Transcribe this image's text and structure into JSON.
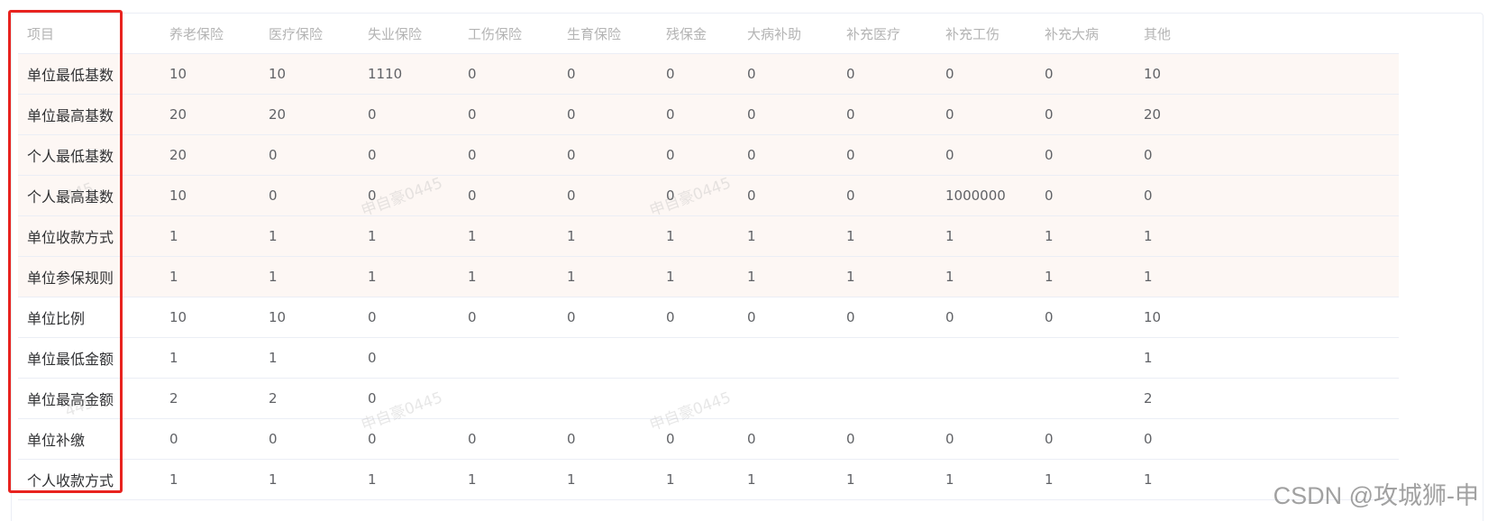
{
  "table": {
    "headers": [
      "项目",
      "养老保险",
      "医疗保险",
      "失业保险",
      "工伤保险",
      "生育保险",
      "残保金",
      "大病补助",
      "补充医疗",
      "补充工伤",
      "补充大病",
      "其他"
    ],
    "rows": [
      [
        "单位最低基数",
        "10",
        "10",
        "1110",
        "0",
        "0",
        "0",
        "0",
        "0",
        "0",
        "0",
        "10"
      ],
      [
        "单位最高基数",
        "20",
        "20",
        "0",
        "0",
        "0",
        "0",
        "0",
        "0",
        "0",
        "0",
        "20"
      ],
      [
        "个人最低基数",
        "20",
        "0",
        "0",
        "0",
        "0",
        "0",
        "0",
        "0",
        "0",
        "0",
        "0"
      ],
      [
        "个人最高基数",
        "10",
        "0",
        "0",
        "0",
        "0",
        "0",
        "0",
        "0",
        "1000000",
        "0",
        "0"
      ],
      [
        "单位收款方式",
        "1",
        "1",
        "1",
        "1",
        "1",
        "1",
        "1",
        "1",
        "1",
        "1",
        "1"
      ],
      [
        "单位参保规则",
        "1",
        "1",
        "1",
        "1",
        "1",
        "1",
        "1",
        "1",
        "1",
        "1",
        "1"
      ],
      [
        "单位比例",
        "10",
        "10",
        "0",
        "0",
        "0",
        "0",
        "0",
        "0",
        "0",
        "0",
        "10"
      ],
      [
        "单位最低金额",
        "1",
        "1",
        "0",
        "",
        "",
        "",
        "",
        "",
        "",
        "",
        "1"
      ],
      [
        "单位最高金额",
        "2",
        "2",
        "0",
        "",
        "",
        "",
        "",
        "",
        "",
        "",
        "2"
      ],
      [
        "单位补缴",
        "0",
        "0",
        "0",
        "0",
        "0",
        "0",
        "0",
        "0",
        "0",
        "0",
        "0"
      ],
      [
        "个人收款方式",
        "1",
        "1",
        "1",
        "1",
        "1",
        "1",
        "1",
        "1",
        "1",
        "1",
        "1"
      ]
    ]
  },
  "watermark": {
    "text": "申自豪0445",
    "fragment": "445"
  },
  "footer_watermark": "CSDN @攻城狮-申",
  "colors": {
    "highlight_frame": "#e8231f",
    "highlight_row_bg": "#fdf7f4",
    "header_text": "#b4b4b4",
    "cell_text": "#606266",
    "border": "#ebeef5"
  }
}
